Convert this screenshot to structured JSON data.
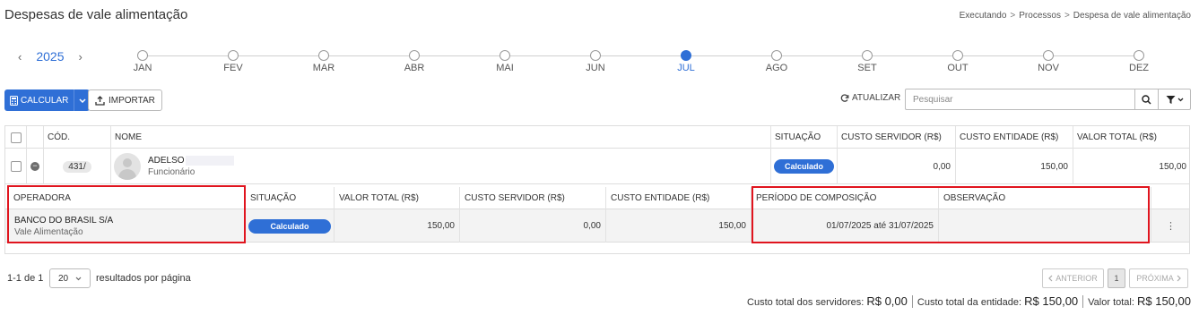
{
  "page": {
    "title": "Despesas de vale alimentação"
  },
  "breadcrumb": [
    "Executando",
    "Processos",
    "Despesa de vale alimentação"
  ],
  "breadcrumb_sep": ">",
  "timeline": {
    "year": "2025",
    "prev": "‹",
    "next": "›",
    "months": [
      "JAN",
      "FEV",
      "MAR",
      "ABR",
      "MAI",
      "JUN",
      "JUL",
      "AGO",
      "SET",
      "OUT",
      "NOV",
      "DEZ"
    ],
    "active": "JUL"
  },
  "toolbar": {
    "calc_label": "CALCULAR",
    "import_label": "IMPORTAR",
    "refresh_label": "ATUALIZAR",
    "search_placeholder": "Pesquisar"
  },
  "table": {
    "headers": {
      "code": "CÓD.",
      "name": "NOME",
      "status": "SITUAÇÃO",
      "server_cost": "CUSTO SERVIDOR (R$)",
      "entity_cost": "CUSTO ENTIDADE (R$)",
      "total": "VALOR TOTAL (R$)"
    },
    "row": {
      "code": "431/",
      "name": "ADELSO",
      "role": "Funcionário",
      "status": "Calculado",
      "server_cost": "0,00",
      "entity_cost": "150,00",
      "total": "150,00"
    },
    "sub_headers": {
      "operator": "OPERADORA",
      "status": "SITUAÇÃO",
      "total": "VALOR TOTAL (R$)",
      "server_cost": "CUSTO SERVIDOR (R$)",
      "entity_cost": "CUSTO ENTIDADE (R$)",
      "period": "PERÍODO DE COMPOSIÇÃO",
      "note": "OBSERVAÇÃO"
    },
    "sub_row": {
      "operator": "BANCO DO BRASIL S/A",
      "benefit": "Vale Alimentação",
      "status": "Calculado",
      "total": "150,00",
      "server_cost": "0,00",
      "entity_cost": "150,00",
      "period": "01/07/2025 até 31/07/2025",
      "note": ""
    }
  },
  "pagination": {
    "range": "1-1 de 1",
    "per_page": "20",
    "per_page_label": "resultados por página",
    "prev": "ANTERIOR",
    "page": "1",
    "next": "PRÓXIMA"
  },
  "totals": {
    "server_label": "Custo total dos servidores:",
    "server_value": "R$ 0,00",
    "entity_label": "Custo total da entidade:",
    "entity_value": "R$ 150,00",
    "total_label": "Valor total:",
    "total_value": "R$ 150,00"
  },
  "colors": {
    "accent": "#2f6fd6",
    "highlight": "#e0141e"
  }
}
